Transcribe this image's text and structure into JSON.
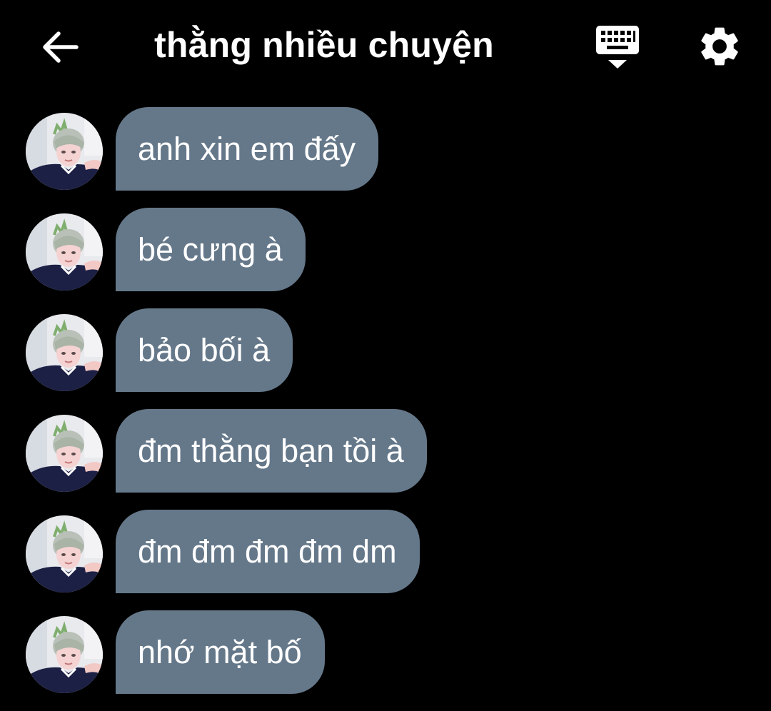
{
  "colors": {
    "background": "#000000",
    "bubble": "#65788a",
    "text": "#ffffff"
  },
  "header": {
    "title": "thằng nhiều chuyện",
    "back_icon": "arrow-left-icon",
    "keyboard_icon": "keyboard-hide-icon",
    "settings_icon": "gear-icon"
  },
  "messages": [
    {
      "text": "anh xin em đấy",
      "avatar": "contact-avatar"
    },
    {
      "text": "bé cưng à",
      "avatar": "contact-avatar"
    },
    {
      "text": "bảo bối à",
      "avatar": "contact-avatar"
    },
    {
      "text": "đm thằng bạn tồi à",
      "avatar": "contact-avatar"
    },
    {
      "text": "đm đm đm đm dm",
      "avatar": "contact-avatar"
    },
    {
      "text": "nhớ mặt bố",
      "avatar": "contact-avatar"
    }
  ]
}
